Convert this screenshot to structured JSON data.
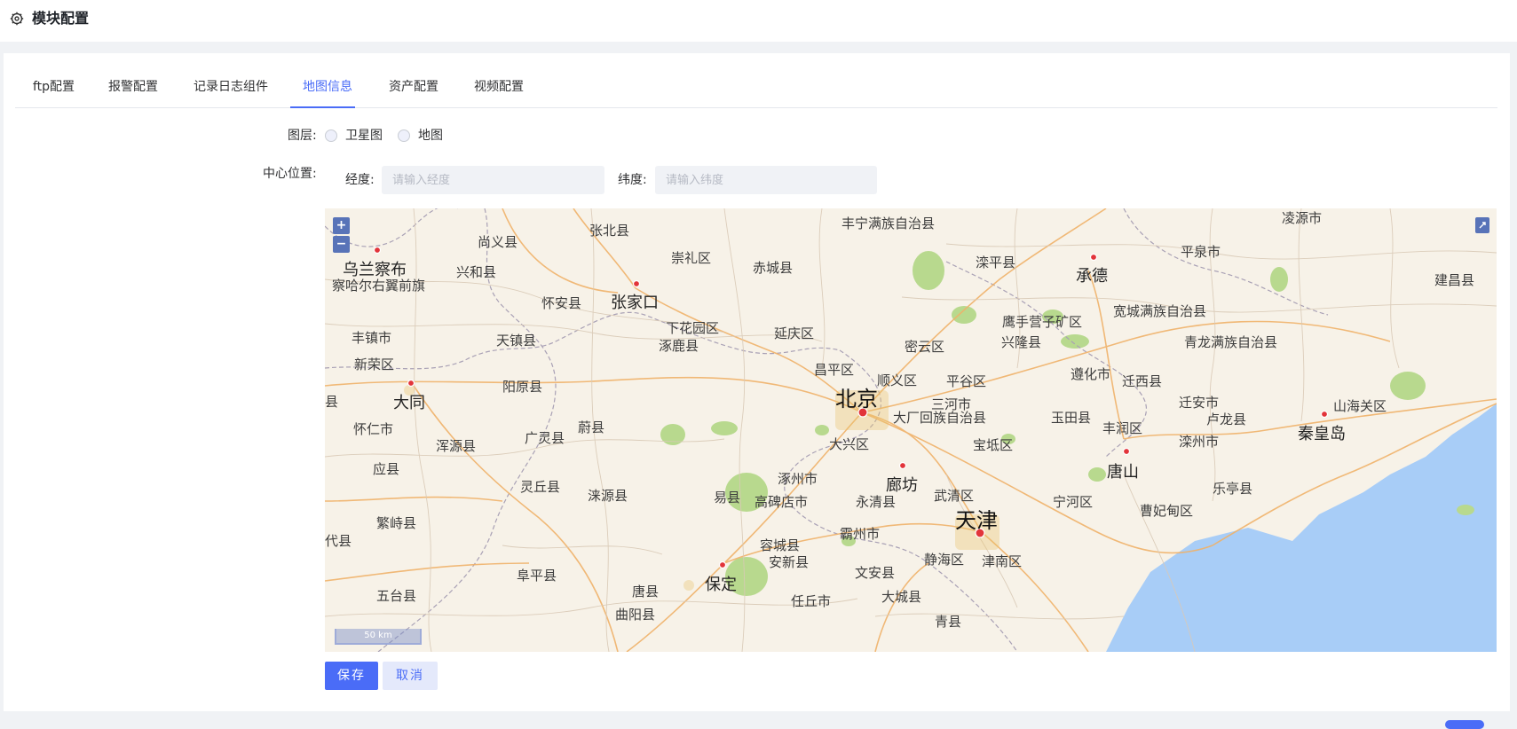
{
  "header": {
    "title": "模块配置",
    "icon": "gear-icon"
  },
  "tabs": [
    {
      "label": "ftp配置",
      "active": false
    },
    {
      "label": "报警配置",
      "active": false
    },
    {
      "label": "记录日志组件",
      "active": false
    },
    {
      "label": "地图信息",
      "active": true
    },
    {
      "label": "资产配置",
      "active": false
    },
    {
      "label": "视频配置",
      "active": false
    }
  ],
  "form": {
    "layer_label": "图层:",
    "layer_options": [
      "卫星图",
      "地图"
    ],
    "center_label": "中心位置:",
    "longitude_label": "经度:",
    "longitude_placeholder": "请输入经度",
    "longitude_value": "",
    "latitude_label": "纬度:",
    "latitude_placeholder": "请输入纬度",
    "latitude_value": ""
  },
  "map": {
    "zoom_in": "+",
    "zoom_out": "−",
    "scale": "50 km",
    "labels": {
      "beijing": "北京",
      "tianjin": "天津",
      "zhangjiakou": "张家口",
      "chengde": "承德",
      "datong": "大同",
      "tangshan": "唐山",
      "qinhuangdao": "秦皇岛",
      "baoding": "保定",
      "langfang": "廊坊",
      "wulanchabu": "乌兰察布",
      "chaharyouyiqian": "察哈尔右翼前旗",
      "shangyi": "尚义县",
      "zhangbei": "张北县",
      "fengning": "丰宁满族自治县",
      "lingyuan": "凌源市",
      "xinghe": "兴和县",
      "chongli": "崇礼区",
      "chicheng": "赤城县",
      "luanping": "滦平县",
      "pingquan": "平泉市",
      "jianchang": "建昌县",
      "huaian": "怀安县",
      "yingshouyingzi": "鹰手营子矿区",
      "kuancheng": "宽城满族自治县",
      "fengzhen": "丰镇市",
      "tianzhen": "天镇县",
      "xiahuayuan": "下花园区",
      "yanqing": "延庆区",
      "xinglong": "兴隆县",
      "qinglong": "青龙满族自治县",
      "xinrong": "新荣区",
      "zhuolu": "涿鹿县",
      "miyun": "密云区",
      "changping": "昌平区",
      "shunyi": "顺义区",
      "pinggu": "平谷区",
      "zunhua": "遵化市",
      "qianxi": "迁西县",
      "yanggao": "阳原县",
      "huairen": "怀仁市",
      "sanhe": "三河市",
      "qianan": "迁安市",
      "lulong": "卢龙县",
      "shanhaiguan": "山海关区",
      "guangling": "广灵县",
      "weixian": "蔚县",
      "dachang": "大厂回族自治县",
      "yutian": "玉田县",
      "fengrun": "丰润区",
      "hunyuan": "浑源县",
      "daxing": "大兴区",
      "baodi": "宝坻区",
      "luanzhou": "滦州市",
      "yingxian": "应县",
      "zhuozhou": "涿州市",
      "lingqiu": "灵丘县",
      "wuqing": "武清区",
      "laoting": "乐亭县",
      "laiyuan": "涞源县",
      "yixian": "易县",
      "gaobeidian": "高碑店市",
      "yongqing": "永清县",
      "ninghe": "宁河区",
      "caofeidian": "曹妃甸区",
      "fanzhi": "繁峙县",
      "bazhou": "霸州市",
      "daixian": "代县",
      "rongcheng": "容城县",
      "anxin": "安新县",
      "jinghai": "静海区",
      "jinnan": "津南区",
      "fuping": "阜平县",
      "wutai": "五台县",
      "wenan": "文安县",
      "tangxian": "唐县",
      "renqiu": "任丘市",
      "dacheng": "大城县",
      "quyang": "曲阳县",
      "qingxian": "青县",
      "yuxian": "县"
    }
  }
}
